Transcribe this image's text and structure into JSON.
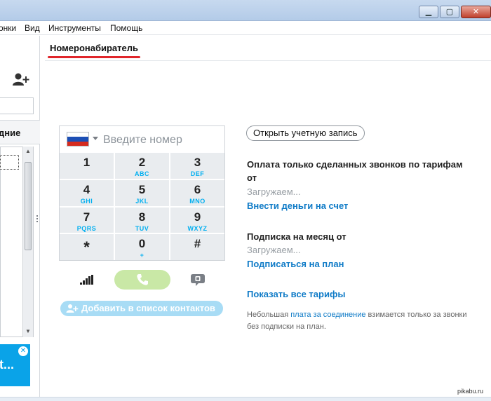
{
  "menu": {
    "items": [
      "онки",
      "Вид",
      "Инструменты",
      "Помощь"
    ]
  },
  "window_controls": {
    "minimize": "▁",
    "maximize": "▢",
    "close": "✕"
  },
  "sidebar": {
    "tab_label": "дние",
    "ad_text": "it..."
  },
  "header": {
    "title": "Номеронабиратель"
  },
  "dialer": {
    "country_flag": "russia-flag",
    "placeholder": "Введите номер",
    "keys": [
      {
        "digit": "1",
        "letters": ""
      },
      {
        "digit": "2",
        "letters": "ABC"
      },
      {
        "digit": "3",
        "letters": "DEF"
      },
      {
        "digit": "4",
        "letters": "GHI"
      },
      {
        "digit": "5",
        "letters": "JKL"
      },
      {
        "digit": "6",
        "letters": "MNO"
      },
      {
        "digit": "7",
        "letters": "PQRS"
      },
      {
        "digit": "8",
        "letters": "TUV"
      },
      {
        "digit": "9",
        "letters": "WXYZ"
      },
      {
        "digit": "*",
        "letters": ""
      },
      {
        "digit": "0",
        "letters": "+"
      },
      {
        "digit": "#",
        "letters": ""
      }
    ],
    "add_contact_label": "Добавить в список контактов"
  },
  "account": {
    "open_account_label": "Открыть учетную запись",
    "pay_heading": "Оплата только сделанных звонков по тарифам от",
    "pay_loading": "Загружаем...",
    "pay_link": "Внести деньги на счет",
    "sub_heading": "Подписка на месяц от",
    "sub_loading": "Загружаем...",
    "sub_link": "Подписаться на план",
    "all_rates_link": "Показать все тарифы",
    "note_prefix": "Небольшая ",
    "note_link": "плата за соединение",
    "note_suffix": " взимается только за звонки без подписки на план."
  },
  "watermark": "pikabu.ru",
  "colors": {
    "accent_blue": "#00aff0",
    "link_blue": "#0f7bc7",
    "tab_underline": "#e0262b",
    "call_green": "#c9e8a6",
    "ad_blue": "#0aa3e8"
  }
}
